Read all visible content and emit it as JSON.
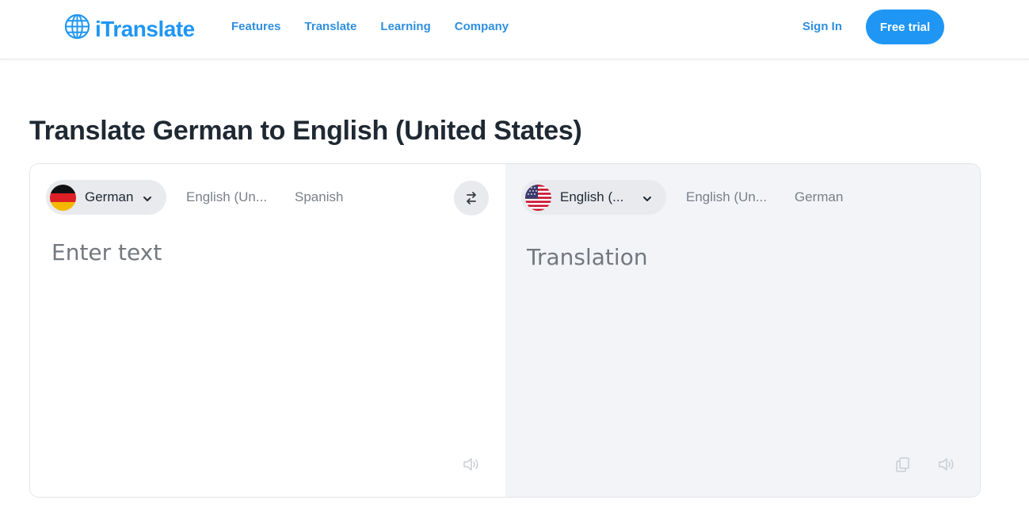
{
  "header": {
    "brand": "iTranslate",
    "nav": [
      "Features",
      "Translate",
      "Learning",
      "Company"
    ],
    "sign_in": "Sign In",
    "free_trial": "Free trial"
  },
  "page_title": "Translate German to English (United States)",
  "source": {
    "selected_language": "German",
    "flag": "germany-flag-icon",
    "recent_languages": [
      "English (Un...",
      "Spanish"
    ],
    "input_placeholder": "Enter text",
    "input_value": ""
  },
  "target": {
    "selected_language": "English (...",
    "flag": "usa-flag-icon",
    "recent_languages": [
      "English (Un...",
      "German"
    ],
    "placeholder": "Translation"
  },
  "colors": {
    "brand": "#1f96f3",
    "link": "#2f8fe0",
    "title": "#1f2933",
    "muted": "#7a8089",
    "target_pane_bg": "#f2f4f7"
  },
  "icons": {
    "logo": "globe-icon",
    "swap": "swap-icon",
    "speaker": "speaker-icon",
    "copy": "copy-icon",
    "dropdown": "chevron-down-icon"
  }
}
